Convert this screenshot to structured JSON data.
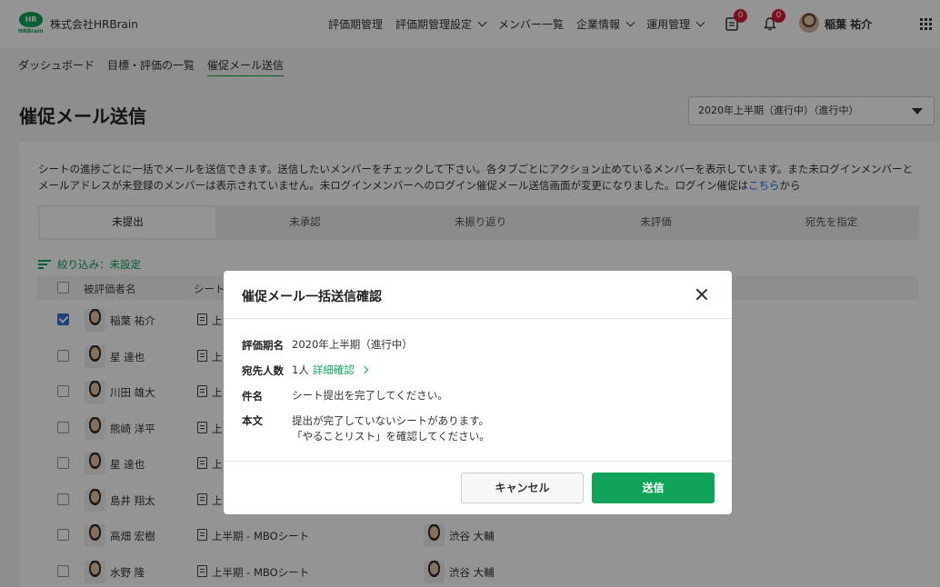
{
  "header": {
    "logo_text": "HR",
    "logo_sub": "HRBrain",
    "company": "株式会社HRBrain",
    "nav": [
      "評価期管理",
      "評価期管理設定",
      "メンバー一覧",
      "企業情報",
      "運用管理"
    ],
    "task_badge": "0",
    "bell_badge": "0",
    "user_name": "稲葉 祐介"
  },
  "breadcrumb": [
    "ダッシュボード",
    "目標・評価の一覧",
    "催促メール送信"
  ],
  "page_title": "催促メール送信",
  "period_select": "2020年上半期（進行中）（進行中）",
  "description_main": "シートの進捗ごとに一括でメールを送信できます。送信したいメンバーをチェックして下さい。各タブごとにアクション止めているメンバーを表示しています。また未ログインメンバーとメールアドレスが未登録のメンバーは表示されていません。未ログインメンバーへのログイン催促メール送信画面が変更になりました。ログイン催促は",
  "description_link": "こちら",
  "description_tail": "から",
  "tabs": [
    "未提出",
    "未承認",
    "未振り返り",
    "未評価",
    "宛先を指定"
  ],
  "filter_label": "絞り込み：未設定",
  "table": {
    "headers": [
      "被評価者名",
      "シート"
    ],
    "rows": [
      {
        "name": "稲葉 祐介",
        "sheet": "上",
        "evaluator": "",
        "checked": true
      },
      {
        "name": "星 達也",
        "sheet": "上",
        "evaluator": "",
        "checked": false
      },
      {
        "name": "川田 雄大",
        "sheet": "上",
        "evaluator": "",
        "checked": false
      },
      {
        "name": "熊崎 洋平",
        "sheet": "上",
        "evaluator": "",
        "checked": false
      },
      {
        "name": "星 達也",
        "sheet": "上",
        "evaluator": "",
        "checked": false
      },
      {
        "name": "島井 翔太",
        "sheet": "上",
        "evaluator": "",
        "checked": false
      },
      {
        "name": "高畑 宏樹",
        "sheet": "上半期 - MBOシート",
        "evaluator": "渋谷 大輔",
        "checked": false
      },
      {
        "name": "水野 隆",
        "sheet": "上半期 - MBOシート",
        "evaluator": "渋谷 大輔",
        "checked": false
      }
    ]
  },
  "modal": {
    "title": "催促メール一括送信確認",
    "period_label": "評価期名",
    "period_value": "2020年上半期（進行中）",
    "recipients_label": "宛先人数",
    "recipients_value": "1人",
    "detail_link": "詳細確認",
    "subject_label": "件名",
    "subject_value": "シート提出を完了してください。",
    "body_label": "本文",
    "body_line1": "提出が完了していないシートがあります。",
    "body_line2": "「やることリスト」を確認してください。",
    "cancel_label": "キャンセル",
    "send_label": "送信"
  },
  "colors": {
    "brand": "#10a35a",
    "badge": "#d81b3a",
    "link": "#1a73e8",
    "checkbox": "#3b6fd6"
  }
}
